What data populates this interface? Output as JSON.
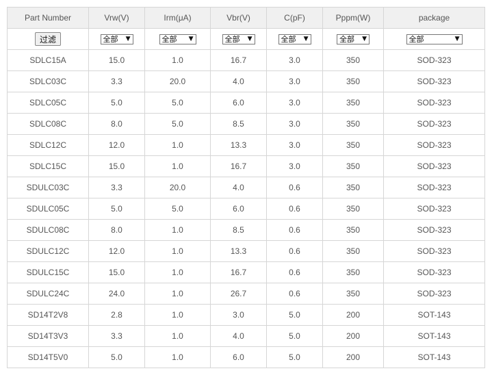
{
  "columns": [
    "Part Number",
    "Vrw(V)",
    "Irm(μA)",
    "Vbr(V)",
    "C(pF)",
    "Pppm(W)",
    "package"
  ],
  "filter": {
    "button_label": "过滤",
    "selects": [
      "全部",
      "全部",
      "全部",
      "全部",
      "全部",
      "全部"
    ]
  },
  "rows": [
    [
      "SDLC15A",
      "15.0",
      "1.0",
      "16.7",
      "3.0",
      "350",
      "SOD-323"
    ],
    [
      "SDLC03C",
      "3.3",
      "20.0",
      "4.0",
      "3.0",
      "350",
      "SOD-323"
    ],
    [
      "SDLC05C",
      "5.0",
      "5.0",
      "6.0",
      "3.0",
      "350",
      "SOD-323"
    ],
    [
      "SDLC08C",
      "8.0",
      "5.0",
      "8.5",
      "3.0",
      "350",
      "SOD-323"
    ],
    [
      "SDLC12C",
      "12.0",
      "1.0",
      "13.3",
      "3.0",
      "350",
      "SOD-323"
    ],
    [
      "SDLC15C",
      "15.0",
      "1.0",
      "16.7",
      "3.0",
      "350",
      "SOD-323"
    ],
    [
      "SDULC03C",
      "3.3",
      "20.0",
      "4.0",
      "0.6",
      "350",
      "SOD-323"
    ],
    [
      "SDULC05C",
      "5.0",
      "5.0",
      "6.0",
      "0.6",
      "350",
      "SOD-323"
    ],
    [
      "SDULC08C",
      "8.0",
      "1.0",
      "8.5",
      "0.6",
      "350",
      "SOD-323"
    ],
    [
      "SDULC12C",
      "12.0",
      "1.0",
      "13.3",
      "0.6",
      "350",
      "SOD-323"
    ],
    [
      "SDULC15C",
      "15.0",
      "1.0",
      "16.7",
      "0.6",
      "350",
      "SOD-323"
    ],
    [
      "SDULC24C",
      "24.0",
      "1.0",
      "26.7",
      "0.6",
      "350",
      "SOD-323"
    ],
    [
      "SD14T2V8",
      "2.8",
      "1.0",
      "3.0",
      "5.0",
      "200",
      "SOT-143"
    ],
    [
      "SD14T3V3",
      "3.3",
      "1.0",
      "4.0",
      "5.0",
      "200",
      "SOT-143"
    ],
    [
      "SD14T5V0",
      "5.0",
      "1.0",
      "6.0",
      "5.0",
      "200",
      "SOT-143"
    ]
  ]
}
